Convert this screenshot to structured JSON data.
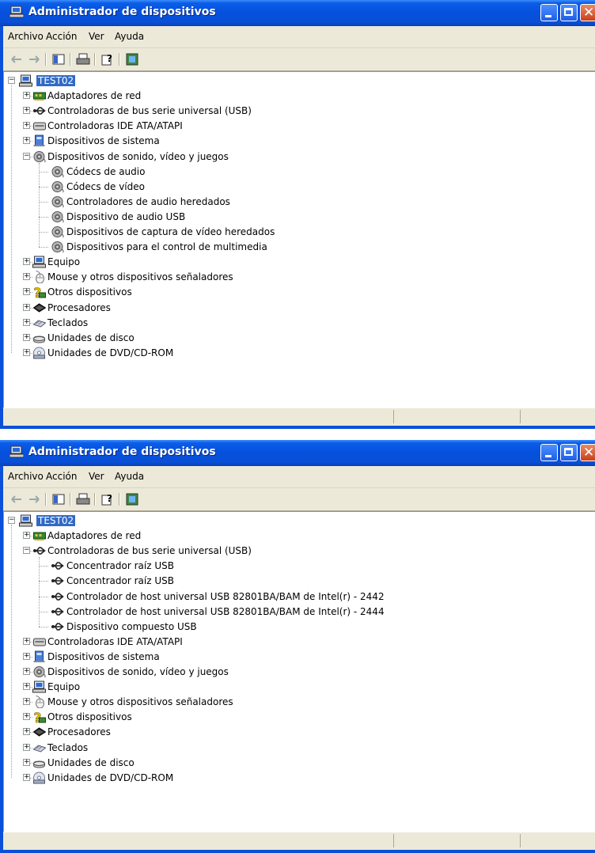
{
  "window1": {
    "title": "Administrador de dispositivos",
    "menus": [
      "Archivo",
      "Acción",
      "Ver",
      "Ayuda"
    ],
    "root": "TEST02",
    "nodes": [
      {
        "label": "Adaptadores de red",
        "icon": "network-adapter-icon",
        "expander": "+"
      },
      {
        "label": "Controladoras de bus serie universal (USB)",
        "icon": "usb-icon",
        "expander": "+"
      },
      {
        "label": "Controladoras IDE ATA/ATAPI",
        "icon": "ide-controller-icon",
        "expander": "+"
      },
      {
        "label": "Dispositivos de sistema",
        "icon": "system-device-icon",
        "expander": "+"
      },
      {
        "label": "Dispositivos de sonido, vídeo y juegos",
        "icon": "sound-icon",
        "expander": "-",
        "children": [
          {
            "label": "Códecs de audio",
            "icon": "sound-icon"
          },
          {
            "label": "Códecs de vídeo",
            "icon": "sound-icon"
          },
          {
            "label": "Controladores de audio heredados",
            "icon": "sound-icon"
          },
          {
            "label": "Dispositivo de audio USB",
            "icon": "sound-icon"
          },
          {
            "label": "Dispositivos de captura de vídeo heredados",
            "icon": "sound-icon"
          },
          {
            "label": "Dispositivos para el control de multimedia",
            "icon": "sound-icon"
          }
        ]
      },
      {
        "label": "Equipo",
        "icon": "computer-icon",
        "expander": "+"
      },
      {
        "label": "Mouse y otros dispositivos señaladores",
        "icon": "mouse-icon",
        "expander": "+"
      },
      {
        "label": "Otros dispositivos",
        "icon": "question-icon",
        "expander": "+"
      },
      {
        "label": "Procesadores",
        "icon": "processor-icon",
        "expander": "+"
      },
      {
        "label": "Teclados",
        "icon": "keyboard-icon",
        "expander": "+"
      },
      {
        "label": "Unidades de disco",
        "icon": "disk-drive-icon",
        "expander": "+"
      },
      {
        "label": "Unidades de DVD/CD-ROM",
        "icon": "cdrom-icon",
        "expander": "+"
      }
    ]
  },
  "window2": {
    "title": "Administrador de dispositivos",
    "menus": [
      "Archivo",
      "Acción",
      "Ver",
      "Ayuda"
    ],
    "root": "TEST02",
    "nodes": [
      {
        "label": "Adaptadores de red",
        "icon": "network-adapter-icon",
        "expander": "+"
      },
      {
        "label": "Controladoras de bus serie universal (USB)",
        "icon": "usb-icon",
        "expander": "-",
        "children": [
          {
            "label": "Concentrador raíz USB",
            "icon": "usb-icon"
          },
          {
            "label": "Concentrador raíz USB",
            "icon": "usb-icon"
          },
          {
            "label": "Controlador de host universal USB 82801BA/BAM de Intel(r) - 2442",
            "icon": "usb-icon"
          },
          {
            "label": "Controlador de host universal USB 82801BA/BAM de Intel(r) - 2444",
            "icon": "usb-icon"
          },
          {
            "label": "Dispositivo compuesto USB",
            "icon": "usb-icon"
          }
        ]
      },
      {
        "label": "Controladoras IDE ATA/ATAPI",
        "icon": "ide-controller-icon",
        "expander": "+"
      },
      {
        "label": "Dispositivos de sistema",
        "icon": "system-device-icon",
        "expander": "+"
      },
      {
        "label": "Dispositivos de sonido, vídeo y juegos",
        "icon": "sound-icon",
        "expander": "+"
      },
      {
        "label": "Equipo",
        "icon": "computer-icon",
        "expander": "+"
      },
      {
        "label": "Mouse y otros dispositivos señaladores",
        "icon": "mouse-icon",
        "expander": "+"
      },
      {
        "label": "Otros dispositivos",
        "icon": "question-icon",
        "expander": "+"
      },
      {
        "label": "Procesadores",
        "icon": "processor-icon",
        "expander": "+"
      },
      {
        "label": "Teclados",
        "icon": "keyboard-icon",
        "expander": "+"
      },
      {
        "label": "Unidades de disco",
        "icon": "disk-drive-icon",
        "expander": "+"
      },
      {
        "label": "Unidades de DVD/CD-ROM",
        "icon": "cdrom-icon",
        "expander": "+"
      }
    ]
  },
  "colors": {
    "titlebar": "#0550dd",
    "selection": "#316ac5",
    "frame": "#ece9d8"
  }
}
